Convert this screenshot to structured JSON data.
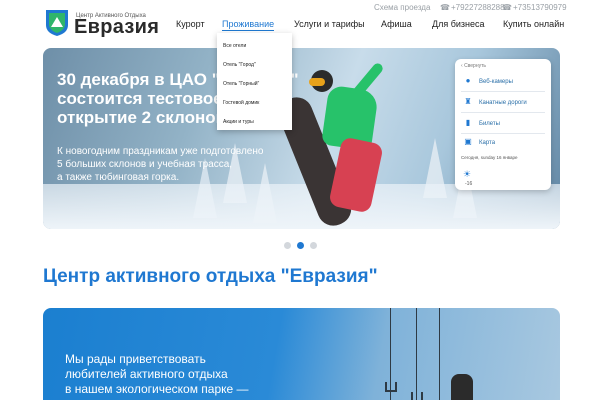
{
  "header": {
    "logo_subtitle": "Центр Активного Отдыха",
    "logo_name": "Евразия",
    "top_links": {
      "route": "Схема проезда",
      "phone1": "+79227288288",
      "phone2": "+73513790979"
    },
    "nav": [
      {
        "label": "Курорт"
      },
      {
        "label": "Проживание"
      },
      {
        "label": "Услуги и тарифы"
      },
      {
        "label": "Афиша"
      },
      {
        "label": "Для бизнеса"
      },
      {
        "label": "Купить онлайн"
      }
    ],
    "active_nav": "Проживание"
  },
  "dropdown": {
    "items": [
      "Все отели",
      "Отель \"Город\"",
      "Отель \"Горный\"",
      "Гостевой домик",
      "Акции и туры"
    ]
  },
  "hero": {
    "title_lines": [
      "30 декабря в ЦАО \"Евразия\"",
      "состоится тестовое",
      "открытие 2 склонов"
    ],
    "text_lines": [
      "К новогодним праздникам уже подготовлено",
      "5 больших склонов и учебная трасса,",
      "а также тюбинговая горка."
    ]
  },
  "panel": {
    "back": "Свернуть",
    "items": [
      {
        "label": "Веб-камеры",
        "icon": "pin-icon"
      },
      {
        "label": "Канатные дороги",
        "icon": "lift-icon"
      },
      {
        "label": "Билеты",
        "icon": "ticket-icon"
      },
      {
        "label": "Карта",
        "icon": "map-icon"
      }
    ],
    "weather_label": "Сегодня, sunday 16 январе",
    "temperature": "-16"
  },
  "slider": {
    "count": 3,
    "active": 1
  },
  "section_title": "Центр активного отдыха \"Евразия\"",
  "banner": {
    "text_lines": [
      "Мы рады приветствовать",
      "любителей активного отдыха",
      "в нашем экологическом парке —"
    ]
  },
  "colors": {
    "accent": "#1f78d1",
    "text": "#222222"
  }
}
